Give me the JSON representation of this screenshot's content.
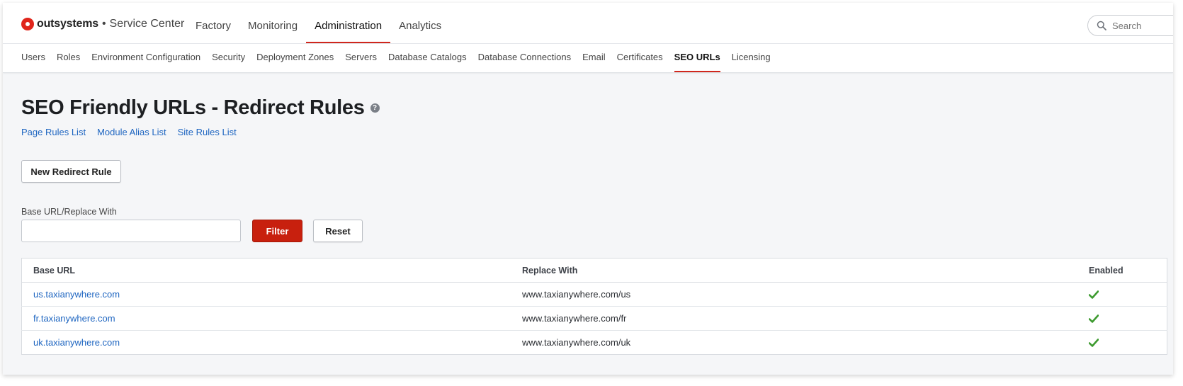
{
  "brand": {
    "name": "outsystems",
    "separator": "•",
    "app": "Service Center"
  },
  "main_nav": [
    {
      "label": "Factory",
      "active": false
    },
    {
      "label": "Monitoring",
      "active": false
    },
    {
      "label": "Administration",
      "active": true
    },
    {
      "label": "Analytics",
      "active": false
    }
  ],
  "search": {
    "placeholder": "Search"
  },
  "sub_nav": [
    {
      "label": "Users",
      "active": false
    },
    {
      "label": "Roles",
      "active": false
    },
    {
      "label": "Environment Configuration",
      "active": false
    },
    {
      "label": "Security",
      "active": false
    },
    {
      "label": "Deployment Zones",
      "active": false
    },
    {
      "label": "Servers",
      "active": false
    },
    {
      "label": "Database Catalogs",
      "active": false
    },
    {
      "label": "Database Connections",
      "active": false
    },
    {
      "label": "Email",
      "active": false
    },
    {
      "label": "Certificates",
      "active": false
    },
    {
      "label": "SEO URLs",
      "active": true
    },
    {
      "label": "Licensing",
      "active": false
    }
  ],
  "page": {
    "title": "SEO Friendly URLs - Redirect Rules",
    "help": "?",
    "links": [
      "Page Rules List",
      "Module Alias List",
      "Site Rules List"
    ],
    "new_button": "New Redirect Rule",
    "filter_label": "Base URL/Replace With",
    "filter_value": "",
    "filter_button": "Filter",
    "reset_button": "Reset"
  },
  "table": {
    "columns": [
      "Base URL",
      "Replace With",
      "Enabled"
    ],
    "rows": [
      {
        "base_url": "us.taxianywhere.com",
        "replace_with": "www.taxianywhere.com/us",
        "enabled": true
      },
      {
        "base_url": "fr.taxianywhere.com",
        "replace_with": "www.taxianywhere.com/fr",
        "enabled": true
      },
      {
        "base_url": "uk.taxianywhere.com",
        "replace_with": "www.taxianywhere.com/uk",
        "enabled": true
      }
    ]
  },
  "colors": {
    "accent": "#d0271d",
    "primary_button": "#c8200e",
    "link": "#1f66c1",
    "check": "#3c9a2e"
  },
  "icons": {
    "search": "search-icon",
    "help": "help-icon",
    "enabled": "check-icon"
  }
}
